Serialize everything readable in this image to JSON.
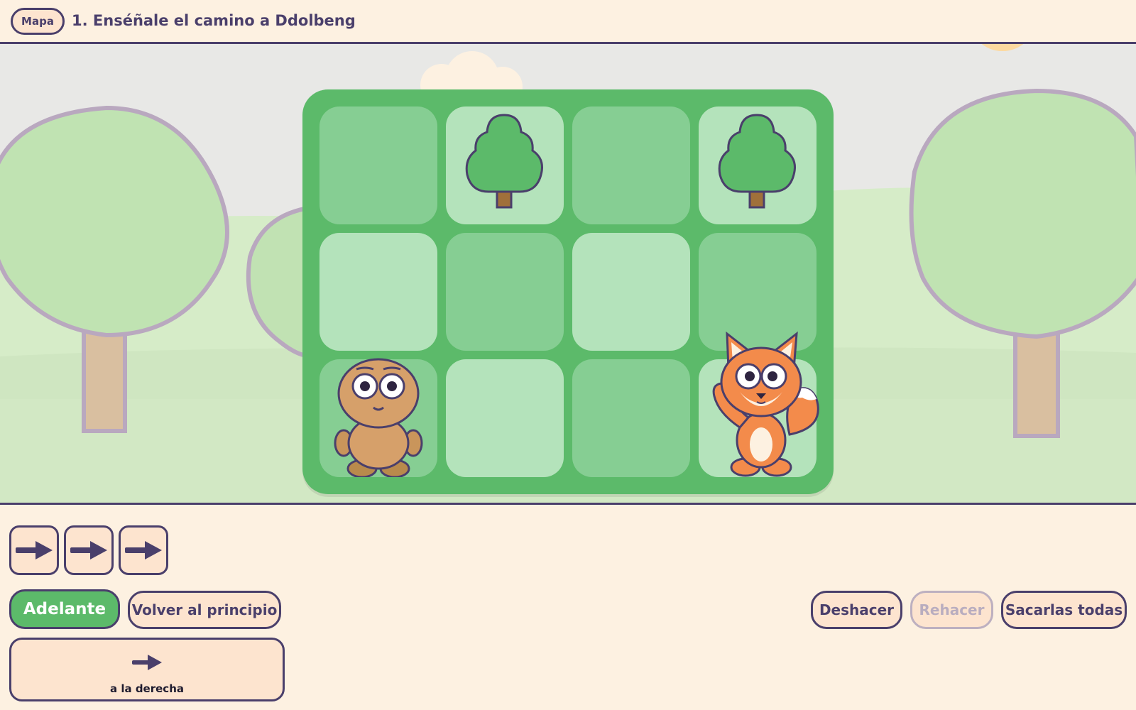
{
  "header": {
    "map_button": "Mapa",
    "title": "1. Enséñale el camino a Ddolbeng"
  },
  "board": {
    "rows": 3,
    "cols": 4,
    "cells": [
      [
        "dark",
        "light",
        "dark",
        "light"
      ],
      [
        "light",
        "dark",
        "light",
        "dark"
      ],
      [
        "dark",
        "light",
        "dark",
        "light"
      ]
    ],
    "trees": [
      [
        0,
        1
      ],
      [
        0,
        3
      ]
    ],
    "character": {
      "name": "Ddolbeng",
      "row": 2,
      "col": 0
    },
    "goal": {
      "name": "fox",
      "row": 2,
      "col": 3
    }
  },
  "program": {
    "commands": [
      "right-arrow-icon",
      "right-arrow-icon",
      "right-arrow-icon"
    ]
  },
  "controls": {
    "run_label": "Adelante",
    "reset_label": "Volver al principio",
    "undo_label": "Deshacer",
    "redo_label": "Rehacer",
    "clear_label": "Sacarlas todas"
  },
  "palette": {
    "right": {
      "icon": "right-arrow-icon",
      "label": "a la derecha"
    }
  },
  "colors": {
    "ink": "#4a3f6b",
    "background": "#fdf1e1",
    "button_fill": "#fde4cf",
    "go_green": "#5cba6a",
    "cell_dark": "#86ce93",
    "cell_light": "#b4e3bb"
  }
}
